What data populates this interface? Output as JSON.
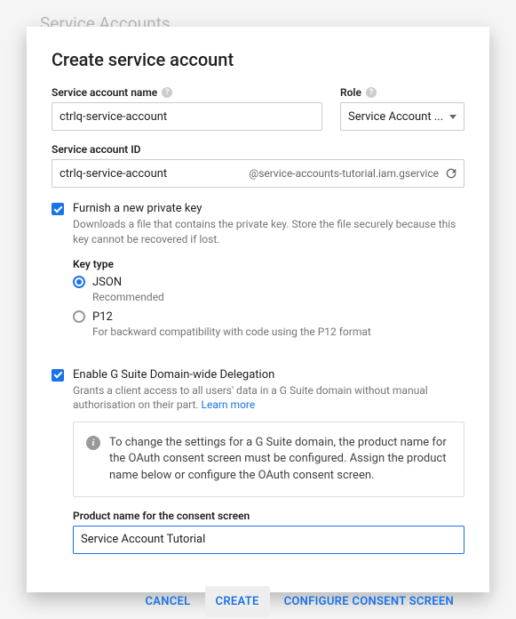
{
  "background": {
    "title": "Service Accounts"
  },
  "dialog": {
    "title": "Create service account",
    "fields": {
      "name_label": "Service account name",
      "name_value": "ctrlq-service-account",
      "role_label": "Role",
      "role_value": "Service Account ...",
      "id_label": "Service account ID",
      "id_value": "ctrlq-service-account",
      "id_suffix": "@service-accounts-tutorial.iam.gservice"
    },
    "furnish": {
      "label": "Furnish a new private key",
      "desc": "Downloads a file that contains the private key. Store the file securely because this key cannot be recovered if lost.",
      "key_type_label": "Key type",
      "json_label": "JSON",
      "json_desc": "Recommended",
      "p12_label": "P12",
      "p12_desc": "For backward compatibility with code using the P12 format"
    },
    "delegation": {
      "label": "Enable G Suite Domain-wide Delegation",
      "desc": "Grants a client access to all users' data in a G Suite domain without manual authorisation on their part. ",
      "learn_more": "Learn more",
      "info_text": "To change the settings for a G Suite domain, the product name for the OAuth consent screen must be configured. Assign the product name below or configure the OAuth consent screen.",
      "product_label": "Product name for the consent screen",
      "product_value": "Service Account Tutorial"
    },
    "actions": {
      "cancel": "CANCEL",
      "create": "CREATE",
      "configure": "CONFIGURE CONSENT SCREEN"
    }
  }
}
